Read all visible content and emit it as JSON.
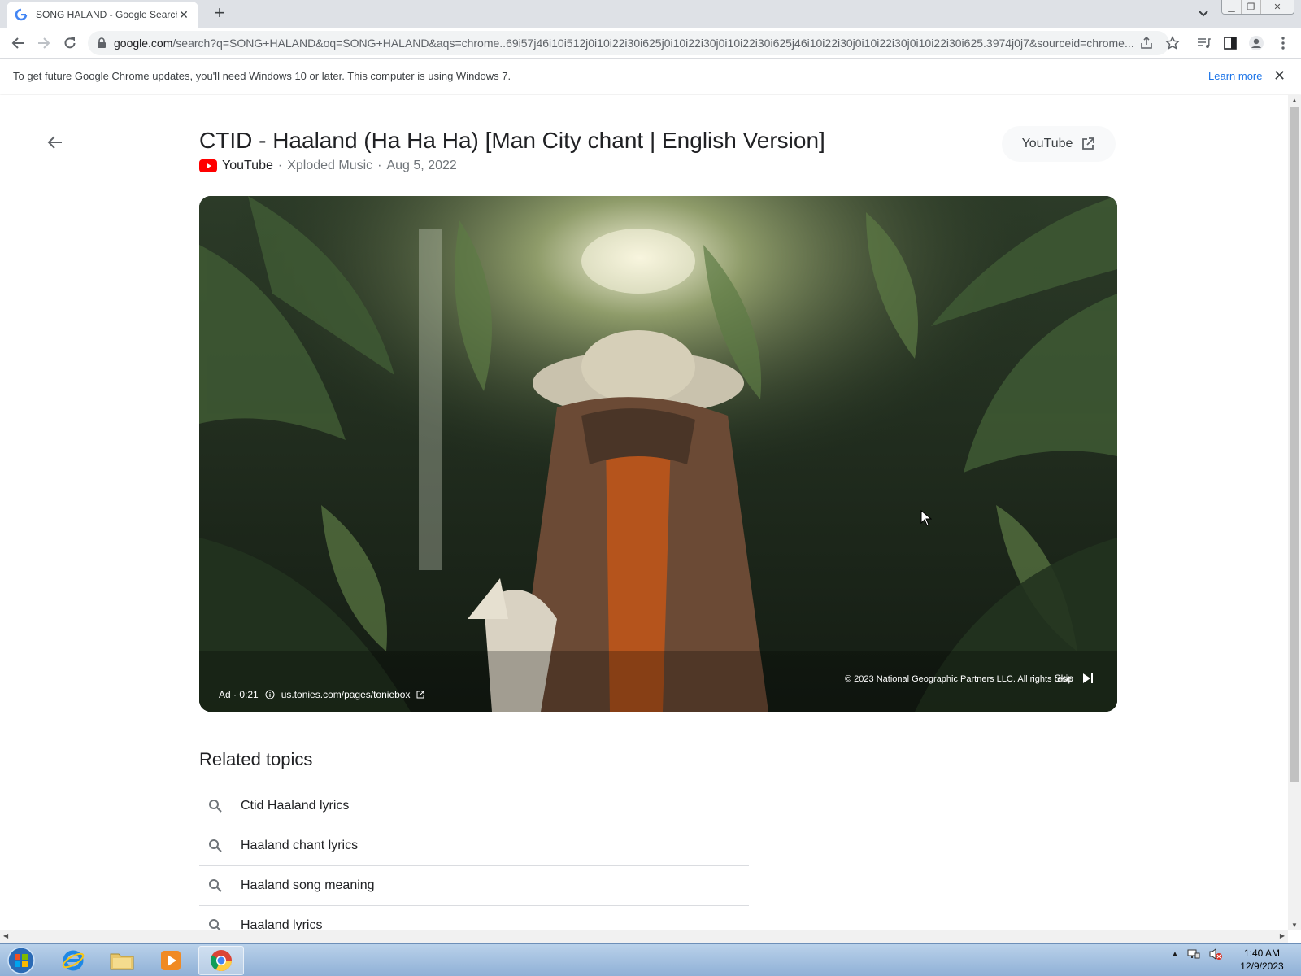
{
  "browser": {
    "tab_title": "SONG HALAND - Google Search",
    "url_host": "google.com",
    "url_rest": "/search?q=SONG+HALAND&oq=SONG+HALAND&aqs=chrome..69i57j46i10i512j0i10i22i30i625j0i10i22i30j0i10i22i30i625j46i10i22i30j0i10i22i30j0i10i22i30i625.3974j0j7&sourceid=chrome..."
  },
  "infobar": {
    "message": "To get future Google Chrome updates, you'll need Windows 10 or later. This computer is using Windows 7.",
    "learn_more": "Learn more"
  },
  "video_page": {
    "title": "CTID - Haaland (Ha Ha Ha) [Man City chant | English Version]",
    "source": "YouTube",
    "channel": "Xploded Music",
    "date": "Aug 5, 2022",
    "open_button": "YouTube"
  },
  "ad": {
    "label": "Ad · 0:21",
    "link": "us.tonies.com/pages/toniebox",
    "copyright": "© 2023 National Geographic Partners LLC. All rights rese",
    "skip": "Skip"
  },
  "related": {
    "heading": "Related topics",
    "items": [
      {
        "label": "Ctid Haaland lyrics"
      },
      {
        "label": "Haaland chant lyrics"
      },
      {
        "label": "Haaland song meaning"
      },
      {
        "label": "Haaland lyrics"
      }
    ]
  },
  "taskbar": {
    "time": "1:40 AM",
    "date": "12/9/2023"
  }
}
